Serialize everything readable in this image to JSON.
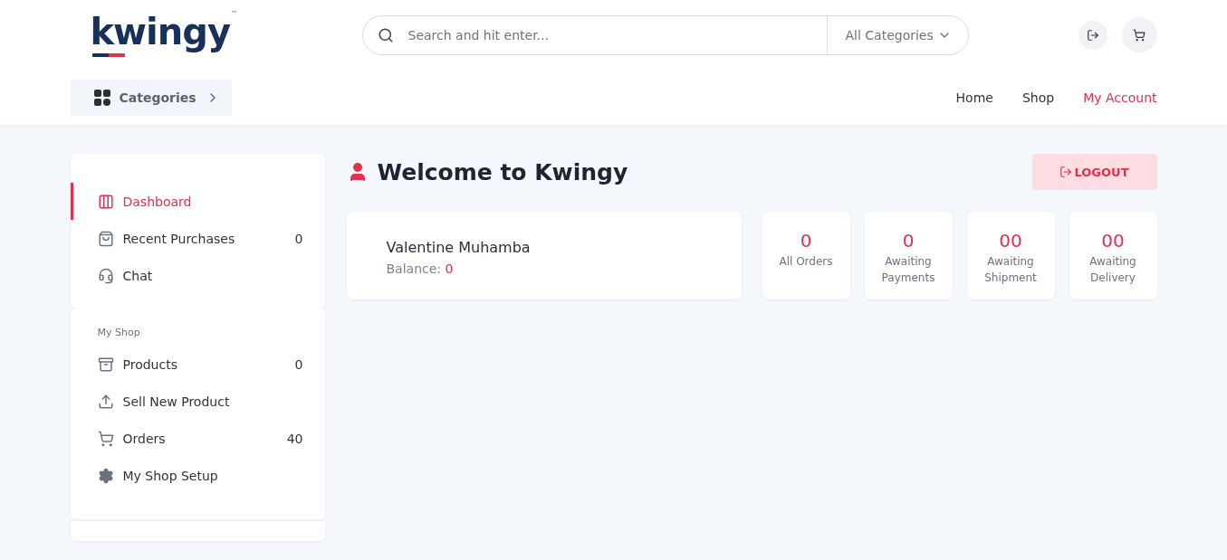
{
  "header": {
    "logo": "kwingy",
    "logo_mark": "™",
    "search": {
      "placeholder": "Search and hit enter..."
    },
    "category_select": "All Categories",
    "categories_button": "Categories",
    "nav": [
      {
        "label": "Home",
        "selected": false
      },
      {
        "label": "Shop",
        "selected": false
      },
      {
        "label": "My Account",
        "selected": true
      }
    ]
  },
  "sidebar": {
    "sections": [
      {
        "items": [
          {
            "label": "Dashboard",
            "selected": true
          },
          {
            "label": "Recent Purchases",
            "count": "0",
            "selected": false
          },
          {
            "label": "Chat",
            "selected": false
          }
        ]
      },
      {
        "title": "My Shop",
        "items": [
          {
            "label": "Products",
            "count": "0",
            "selected": false
          },
          {
            "label": "Sell New Product",
            "selected": false
          },
          {
            "label": "Orders",
            "count": "40",
            "selected": false
          },
          {
            "label": "My Shop Setup",
            "selected": false
          }
        ]
      }
    ]
  },
  "main": {
    "title": "Welcome to Kwingy",
    "logout_button": "LOGOUT",
    "profile": {
      "name": "Valentine Muhamba",
      "balance_label": "Balance:",
      "balance": "0"
    },
    "stats": [
      {
        "value": "0",
        "label": "All Orders"
      },
      {
        "value": "0",
        "label": "Awaiting Payments"
      },
      {
        "value": "00",
        "label": "Awaiting Shipment"
      },
      {
        "value": "00",
        "label": "Awaiting Delivery"
      }
    ]
  }
}
